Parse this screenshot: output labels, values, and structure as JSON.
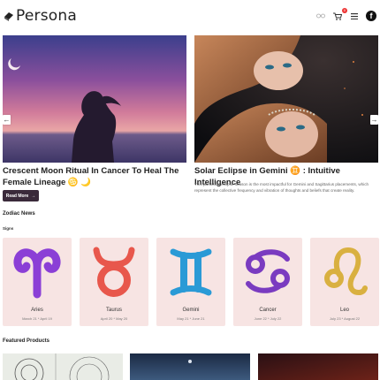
{
  "header": {
    "brand": "Persona",
    "cart_count": "0",
    "icons": [
      "glasses-icon",
      "cart-icon",
      "menu-icon",
      "facebook-icon"
    ]
  },
  "hero": {
    "left": {
      "title": "Crescent Moon Ritual In Cancer To Heal The Female Lineage ♋ 🌙",
      "button": "Read More"
    },
    "right": {
      "title": "Solar Eclipse in Gemini ♊ : Intuitive Intelligence",
      "description": "This particular eclipse season is the most impactful for Gemini and Sagittarius placements, which represent the collective frequency and vibration of thoughts and beliefs that create reality."
    }
  },
  "zodiac": {
    "section_title": "Zodiac News",
    "sub_label": "Signs",
    "signs": [
      {
        "name": "Aries",
        "dates": "March 21 * April 19",
        "color": "#8b3fd6"
      },
      {
        "name": "Taurus",
        "dates": "April 20 * May 20",
        "color": "#e8574c"
      },
      {
        "name": "Gemini",
        "dates": "May 21 * June 21",
        "color": "#2a9ad6"
      },
      {
        "name": "Cancer",
        "dates": "June 22 * July 22",
        "color": "#7a3bc0"
      },
      {
        "name": "Leo",
        "dates": "July 23 * August 22",
        "color": "#d9b040"
      }
    ]
  },
  "products": {
    "section_title": "Featured Products"
  },
  "colors": {
    "card_bg": "#f7e4e3",
    "button_bg": "#3a2a3a",
    "badge": "#e33333"
  }
}
